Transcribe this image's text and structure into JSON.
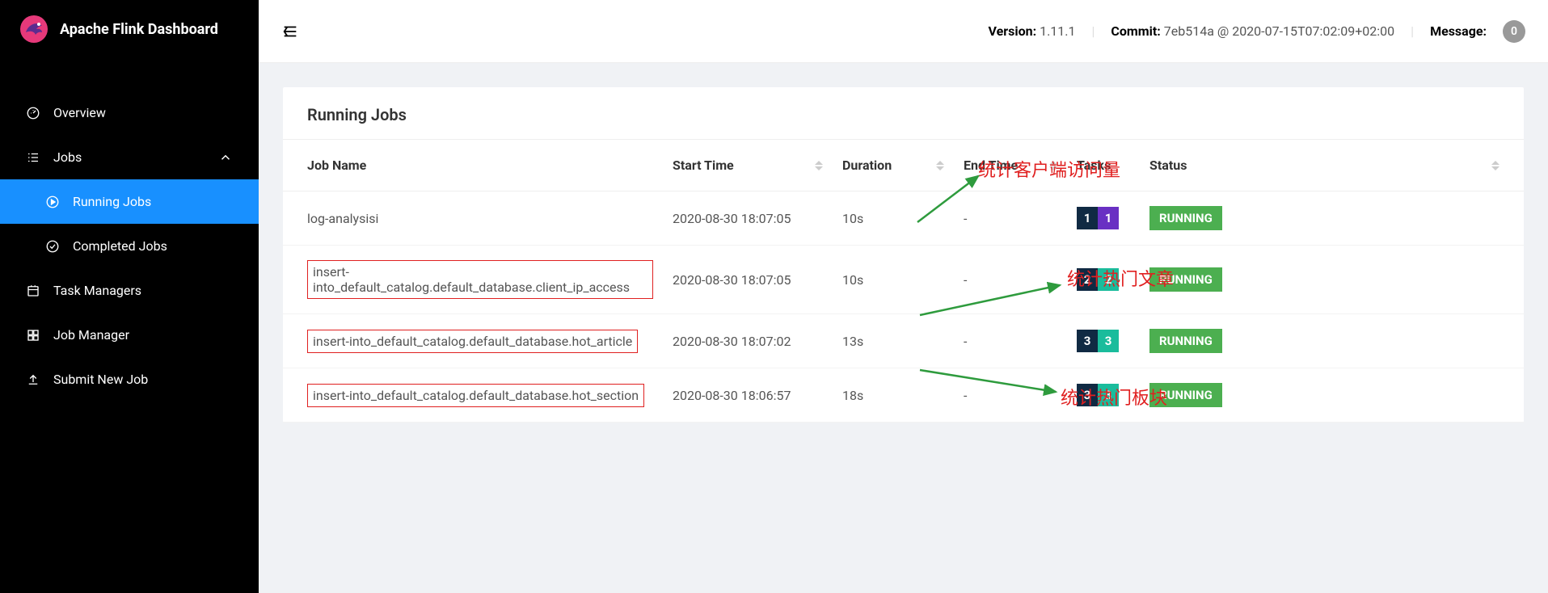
{
  "app_title": "Apache Flink Dashboard",
  "topbar": {
    "version_label": "Version:",
    "version_value": "1.11.1",
    "commit_label": "Commit:",
    "commit_value": "7eb514a @ 2020-07-15T07:02:09+02:00",
    "message_label": "Message:",
    "message_count": "0"
  },
  "sidebar": {
    "overview": "Overview",
    "jobs": "Jobs",
    "running_jobs": "Running Jobs",
    "completed_jobs": "Completed Jobs",
    "task_managers": "Task Managers",
    "job_manager": "Job Manager",
    "submit_new_job": "Submit New Job"
  },
  "page": {
    "title": "Running Jobs",
    "columns": {
      "job_name": "Job Name",
      "start_time": "Start Time",
      "duration": "Duration",
      "end_time": "End Time",
      "tasks": "Tasks",
      "status": "Status"
    }
  },
  "jobs": [
    {
      "name": "log-analysisi",
      "start": "2020-08-30 18:07:05",
      "duration": "10s",
      "end": "-",
      "tasks": [
        "1",
        "1"
      ],
      "task_colors": [
        "dark",
        "purple"
      ],
      "status": "RUNNING",
      "boxed": false
    },
    {
      "name": "insert-into_default_catalog.default_database.client_ip_access",
      "start": "2020-08-30 18:07:05",
      "duration": "10s",
      "end": "-",
      "tasks": [
        "2",
        "2"
      ],
      "task_colors": [
        "dark",
        "teal"
      ],
      "status": "RUNNING",
      "boxed": true
    },
    {
      "name": "insert-into_default_catalog.default_database.hot_article",
      "start": "2020-08-30 18:07:02",
      "duration": "13s",
      "end": "-",
      "tasks": [
        "3",
        "3"
      ],
      "task_colors": [
        "dark",
        "teal"
      ],
      "status": "RUNNING",
      "boxed": true
    },
    {
      "name": "insert-into_default_catalog.default_database.hot_section",
      "start": "2020-08-30 18:06:57",
      "duration": "18s",
      "end": "-",
      "tasks": [
        "3",
        "3"
      ],
      "task_colors": [
        "dark",
        "teal"
      ],
      "status": "RUNNING",
      "boxed": true
    }
  ],
  "annotations": {
    "client_access": "统计客户端访问量",
    "hot_article": "统计热门文章",
    "hot_section": "统计热门板块"
  }
}
